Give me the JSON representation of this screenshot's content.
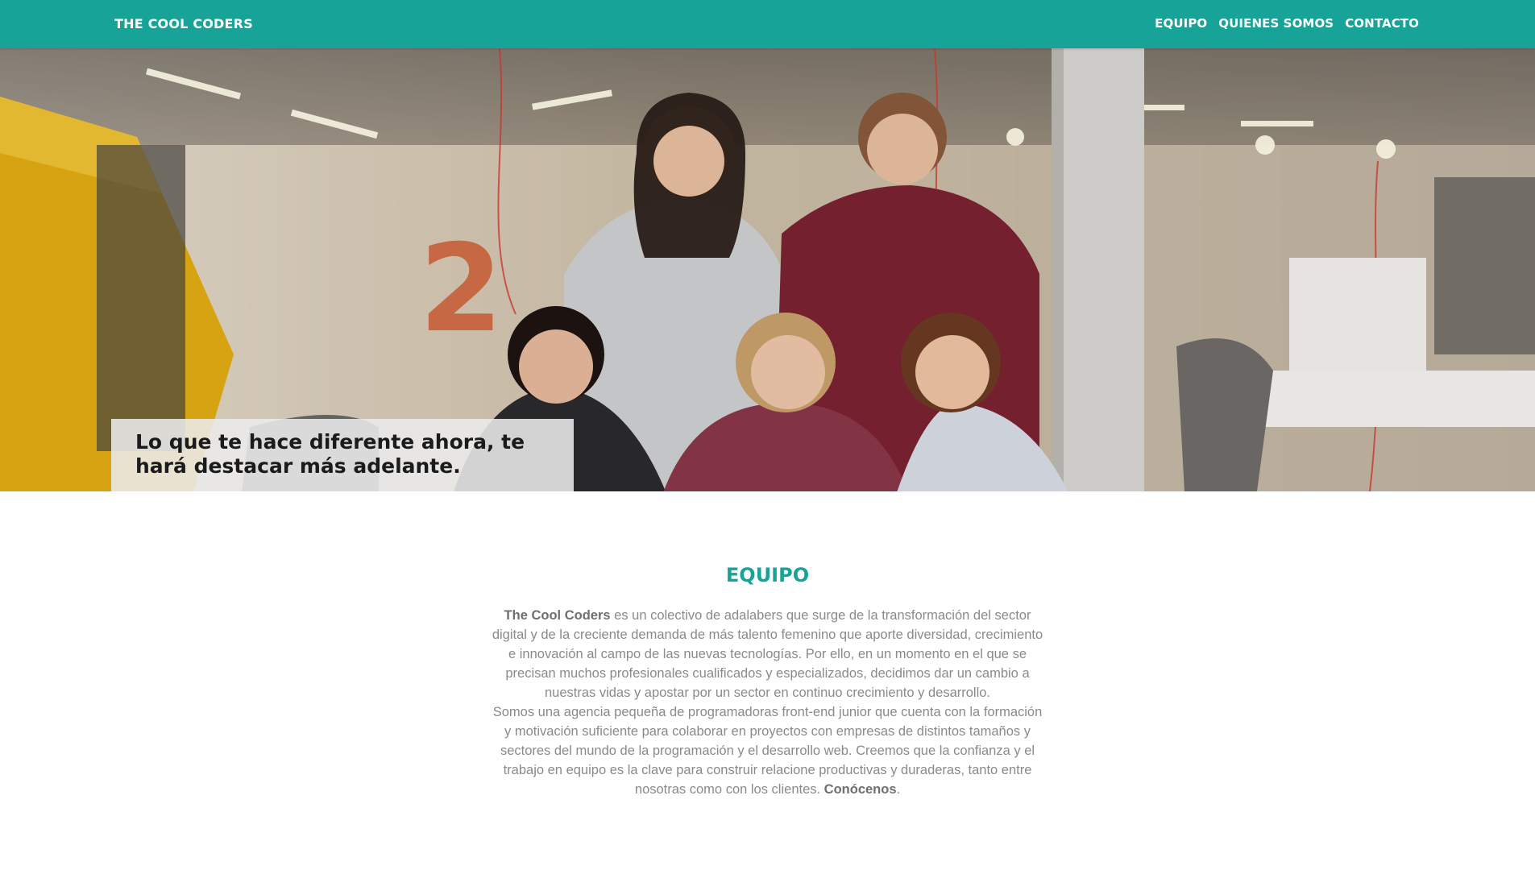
{
  "header": {
    "brand": "THE COOL CODERS",
    "nav": [
      "EQUIPO",
      "QUIENES SOMOS",
      "CONTACTO"
    ]
  },
  "hero": {
    "image_subject": "team-photo",
    "caption": "Lo que te hace diferente ahora, te hará destacar más adelante."
  },
  "equipo": {
    "title": "EQUIPO",
    "p1_strong": "The Cool Coders",
    "p1_rest": " es un colectivo de adalabers que surge de la transformación del sector digital y de la creciente demanda de más talento femenino que aporte diversidad, crecimiento e innovación al campo de las nuevas tecnologías. Por ello, en un momento en el que se precisan muchos profesionales cualificados y especializados, decidimos dar un cambio a nuestras vidas y apostar por un sector en continuo crecimiento y desarrollo.",
    "p2_text": "Somos una agencia pequeña de programadoras front-end junior que cuenta con la formación y motivación suficiente para colaborar en proyectos con empresas de distintos tamaños y sectores del mundo de la programación y el desarrollo web. Creemos que la confianza y el trabajo en equipo es la clave para construir relacione productivas y duraderas, tanto entre nosotras como con los clientes. ",
    "p2_strong": "Conócenos",
    "p2_end": "."
  },
  "colors": {
    "accent": "#17a398",
    "body_text": "#8a8a8a"
  }
}
